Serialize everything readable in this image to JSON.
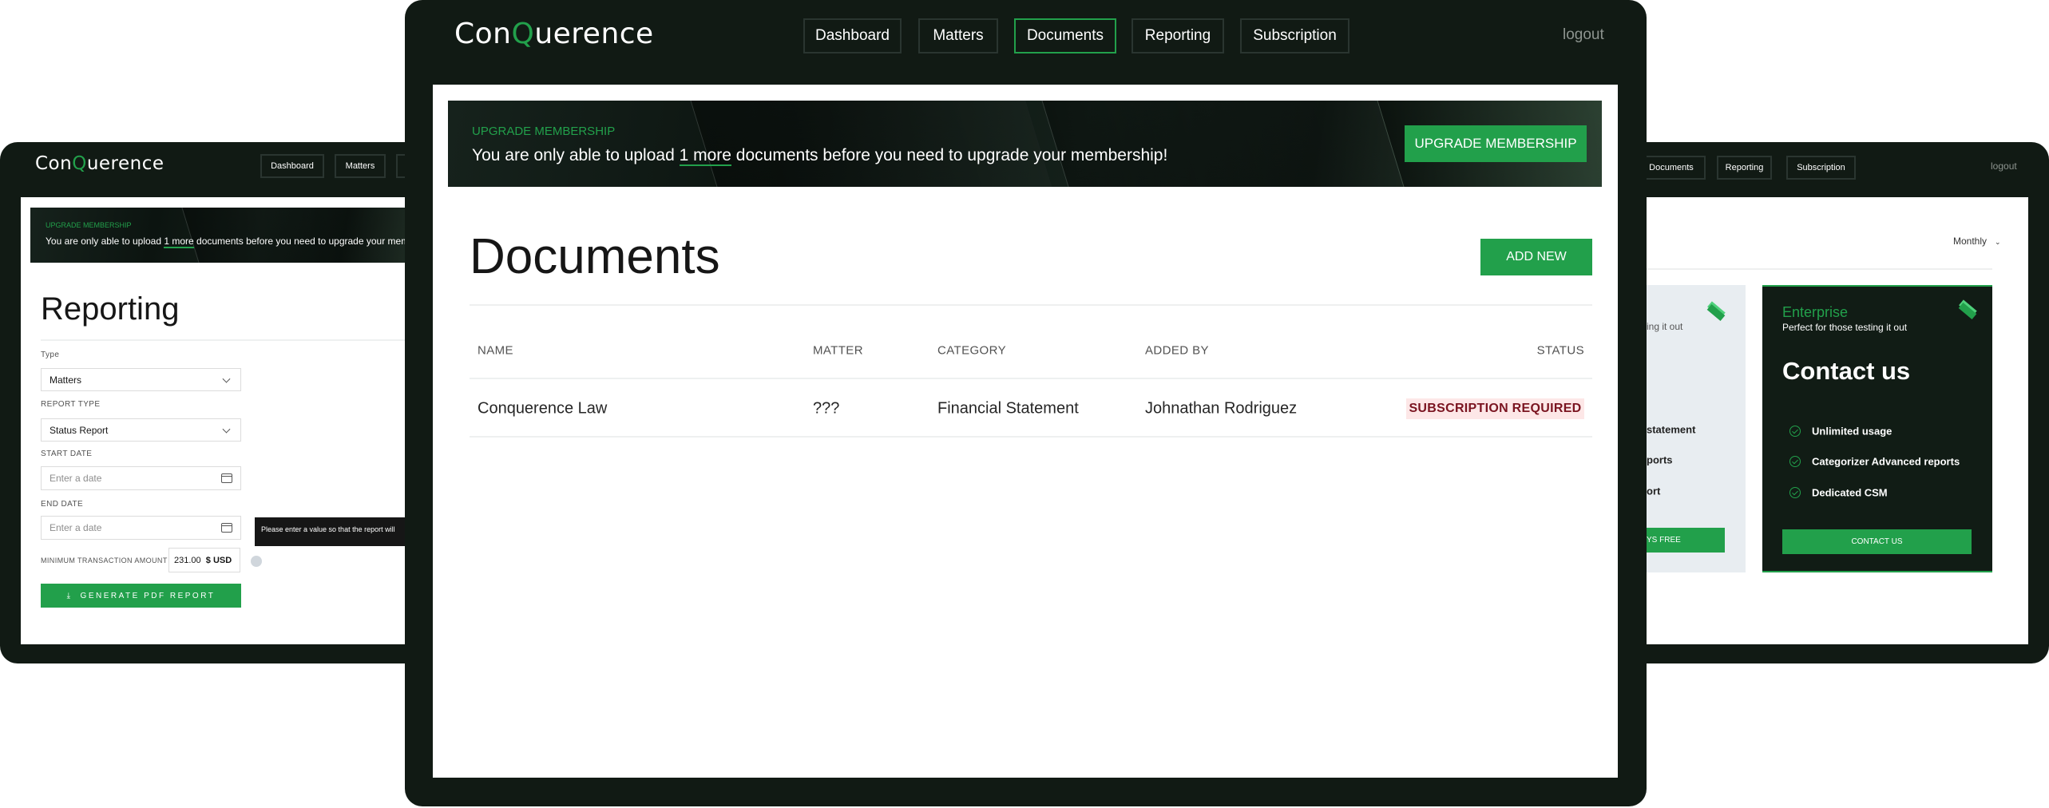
{
  "brand": {
    "logo_prefix": "Con",
    "logo_q": "Q",
    "logo_suffix": "uerence",
    "accent": "#22a04b",
    "frame": "#111a14"
  },
  "main": {
    "nav": [
      {
        "label": "Dashboard"
      },
      {
        "label": "Matters"
      },
      {
        "label": "Documents",
        "active": true
      },
      {
        "label": "Reporting"
      },
      {
        "label": "Subscription"
      }
    ],
    "logout": "logout",
    "banner": {
      "label": "UPGRADE MEMBERSHIP",
      "msg_before": "You are only able to upload ",
      "msg_link": "1 more",
      "msg_after": " documents before you need to upgrade your membership!",
      "button": "UPGRADE MEMBERSHIP"
    },
    "title": "Documents",
    "add_new": "ADD NEW",
    "table": {
      "headers": [
        "NAME",
        "MATTER",
        "CATEGORY",
        "ADDED BY",
        "STATUS"
      ],
      "rows": [
        {
          "name": "Conquerence Law",
          "matter": "???",
          "category": "Financial Statement",
          "added_by": "Johnathan Rodriguez",
          "status": "SUBSCRIPTION REQUIRED"
        }
      ]
    }
  },
  "left": {
    "nav": [
      {
        "label": "Dashboard"
      },
      {
        "label": "Matters"
      }
    ],
    "banner": {
      "label": "UPGRADE MEMBERSHIP",
      "msg_before": "You are only able to upload ",
      "msg_link": "1 more",
      "msg_after": " documents before you need to upgrade your membersh"
    },
    "title": "Reporting",
    "form": {
      "type_label": "Type",
      "type_value": "Matters",
      "report_type_label": "REPORT TYPE",
      "report_type_value": "Status Report",
      "start_label": "START DATE",
      "start_placeholder": "Enter a date",
      "end_label": "END DATE",
      "end_placeholder": "Enter a date",
      "min_label": "MINIMUM TRANSACTION AMOUNT",
      "min_value": "231.00",
      "currency": "$  USD",
      "tooltip": "Please enter a value so that the report will",
      "generate": "GENERATE PDF REPORT"
    }
  },
  "right": {
    "nav": [
      {
        "label": "Documents"
      },
      {
        "label": "Reporting"
      },
      {
        "label": "Subscription"
      }
    ],
    "logout": "logout",
    "period": "Monthly",
    "free_card": {
      "subtitle": "ing it out",
      "features": [
        "statement",
        "ports",
        "ort"
      ],
      "button": "YS FREE"
    },
    "enterprise": {
      "name": "Enterprise",
      "subtitle": "Perfect for those testing it out",
      "price": "Contact us",
      "features": [
        "Unlimited usage",
        "Categorizer Advanced reports",
        "Dedicated CSM"
      ],
      "button": "CONTACT US"
    }
  }
}
